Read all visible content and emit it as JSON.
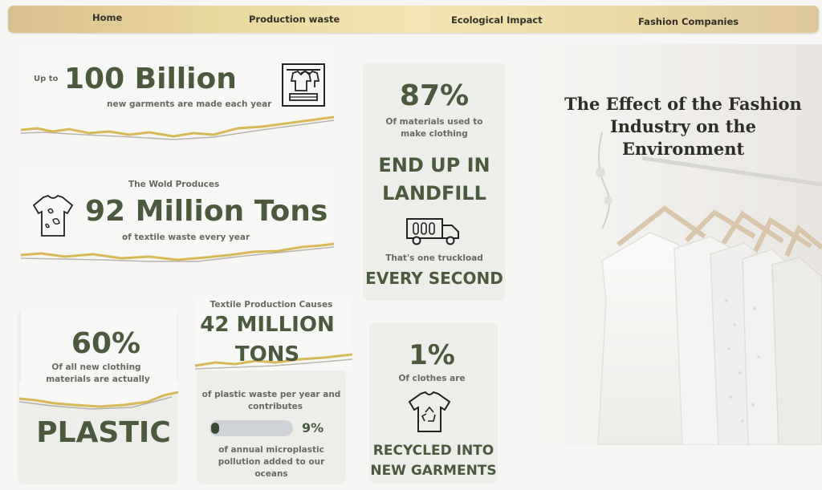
{
  "nav": {
    "items": [
      "Home",
      "Production waste",
      "Ecological Impact",
      "Fashion Companies"
    ]
  },
  "garments": {
    "prefix": "Up to",
    "value": "100 Billion",
    "caption": "new garments are made each year",
    "icon": "clothes-rack-icon"
  },
  "textile": {
    "intro": "The Wold Produces",
    "value": "92 Million Tons",
    "caption": "of textile waste every year",
    "icon": "stained-shirt-icon"
  },
  "landfill": {
    "percent": "87%",
    "caption_line1": "Of materials used to",
    "caption_line2": "make clothing",
    "headline_line1": "END UP IN",
    "headline_line2": "LANDFILL",
    "truck_caption": "That's one truckload",
    "truck_headline": "EVERY SECOND",
    "icon": "garbage-truck-icon"
  },
  "plastic": {
    "percent": "60%",
    "caption_line1": "Of all new clothing",
    "caption_line2": "materials are actually",
    "headline": "PLASTIC"
  },
  "plastic_waste": {
    "intro": "Textile Production Causes",
    "value_line1": "42 MILLION",
    "value_line2": "TONS",
    "caption_line1": "of plastic waste per year and",
    "caption_line2": "contributes",
    "progress_value": 0.09,
    "progress_label": "9%",
    "micro_line1": "of annual microplastic",
    "micro_line2": "pollution added to our",
    "micro_line3": "oceans"
  },
  "recycled": {
    "percent": "1%",
    "caption": "Of clothes are",
    "headline_line1": "RECYCLED INTO",
    "headline_line2": "NEW GARMENTS",
    "icon": "recycle-shirt-icon"
  },
  "title": {
    "line1": "The Effect of the Fashion",
    "line2": "Industry on the",
    "line3": "Environment"
  },
  "colors": {
    "accent": "#4b5a3d",
    "gold": "#d9b85a",
    "nav_gold": "#ead79c"
  }
}
